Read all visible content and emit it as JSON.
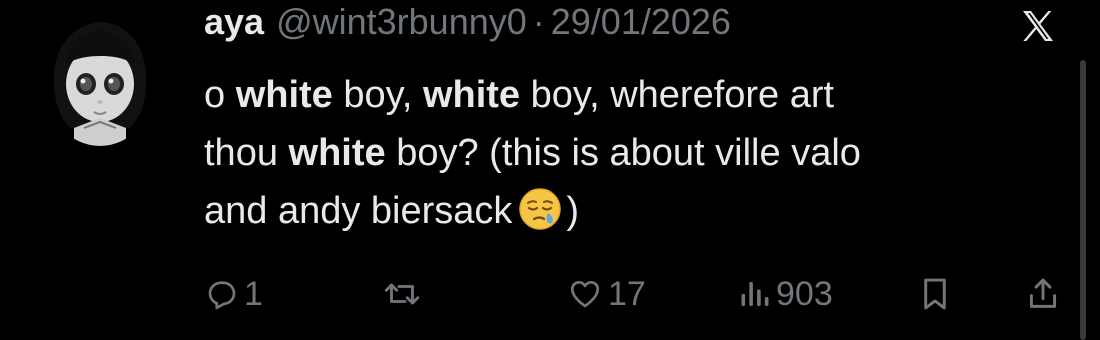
{
  "post": {
    "author_name": "aya",
    "handle": "@wint3rbunny0",
    "separator": "·",
    "date": "29/01/2026",
    "avatar_icon": "doll-avatar-icon",
    "brand_icon": "x-logo-icon",
    "text": {
      "line1": [
        "o ",
        "white",
        " boy, ",
        "white",
        " boy, wherefore art"
      ],
      "line2": [
        "thou ",
        "white",
        " boy? (this is about ville valo"
      ],
      "line3": [
        "and andy biersack",
        ")"
      ],
      "emoji_icon": "sleepy-face-emoji-icon"
    }
  },
  "actions": {
    "replies": "1",
    "reposts": "",
    "likes": "17",
    "views": "903",
    "bookmark_icon": "bookmark-icon",
    "share_icon": "share-icon"
  },
  "colors": {
    "background": "#000000",
    "text_primary": "#e7e9ea",
    "text_secondary": "#71767b"
  }
}
